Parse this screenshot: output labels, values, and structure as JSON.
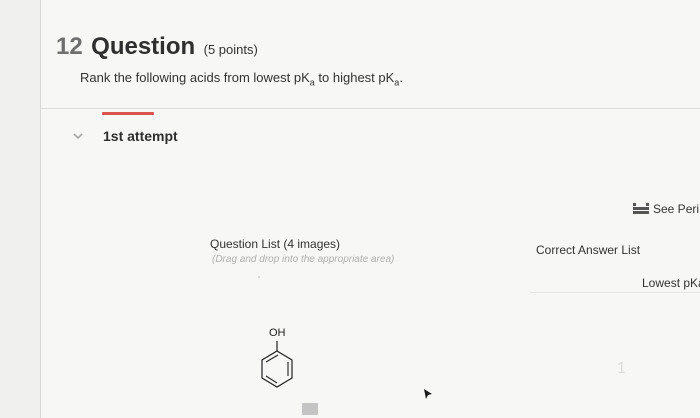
{
  "question": {
    "number": "12",
    "word": "Question",
    "points": "(5 points)",
    "prompt_before_first": "Rank the following acids from lowest pK",
    "prompt_sub1": "a",
    "prompt_middle": " to highest pK",
    "prompt_sub2": "a",
    "prompt_end": "."
  },
  "attempt": {
    "label": "1st attempt"
  },
  "toolbar": {
    "see_periodic": "See Peri",
    "icon": "periodic-table-icon"
  },
  "question_list": {
    "title": "Question List (4 images)",
    "hint": "(Drag and drop into the appropriate area)"
  },
  "answer_list": {
    "title": "Correct Answer List",
    "lowest_label": "Lowest pKa",
    "slot_number": "1"
  },
  "molecules": [
    {
      "label": "OH",
      "icon": "phenol-structure-icon"
    }
  ],
  "colors": {
    "accent": "#d9534f",
    "background": "#f7f7f5"
  }
}
